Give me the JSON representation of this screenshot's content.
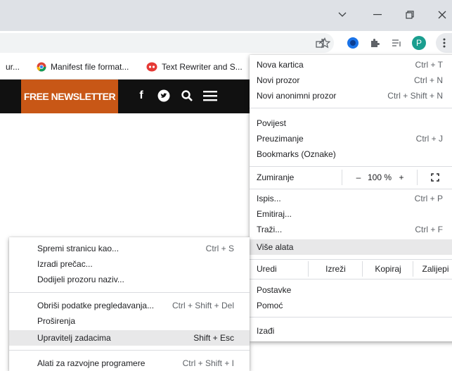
{
  "bookmarks": [
    {
      "label": "ur...",
      "icon": "none"
    },
    {
      "label": "Manifest file format...",
      "icon": "chrome-icon"
    },
    {
      "label": "Text Rewriter and S...",
      "icon": "rewriter-icon"
    }
  ],
  "site": {
    "newsletter": "FREE NEWSLETTER",
    "facebook": "f"
  },
  "profile_initial": "P",
  "main_menu": {
    "items": [
      {
        "label": "Nova kartica",
        "shortcut": "Ctrl + T"
      },
      {
        "label": "Novi prozor",
        "shortcut": "Ctrl + N"
      },
      {
        "label": "Novi anonimni prozor",
        "shortcut": "Ctrl + Shift + N"
      },
      {
        "label": "Povijest",
        "shortcut": ""
      },
      {
        "label": "Preuzimanje",
        "shortcut": "Ctrl + J"
      },
      {
        "label": "Bookmarks (Oznake)",
        "shortcut": ""
      },
      {
        "label": "Ispis...",
        "shortcut": "Ctrl + P"
      },
      {
        "label": "Emitiraj...",
        "shortcut": ""
      },
      {
        "label": "Traži...",
        "shortcut": "Ctrl + F"
      },
      {
        "label": "Više alata",
        "shortcut": ""
      },
      {
        "label": "Postavke",
        "shortcut": ""
      },
      {
        "label": "Pomoć",
        "shortcut": ""
      },
      {
        "label": "Izađi",
        "shortcut": ""
      }
    ],
    "zoom": {
      "label": "Zumiranje",
      "minus": "–",
      "value": "100 %",
      "plus": "+"
    },
    "edit": {
      "label": "Uredi",
      "cut": "Izreži",
      "copy": "Kopiraj",
      "paste": "Zalijepi"
    }
  },
  "submenu": {
    "items": [
      {
        "label": "Spremi stranicu kao...",
        "shortcut": "Ctrl + S"
      },
      {
        "label": "Izradi prečac...",
        "shortcut": ""
      },
      {
        "label": "Dodijeli prozoru naziv...",
        "shortcut": ""
      },
      {
        "label": "Obriši podatke pregledavanja...",
        "shortcut": "Ctrl + Shift + Del"
      },
      {
        "label": "Proširenja",
        "shortcut": ""
      },
      {
        "label": "Upravitelj zadacima",
        "shortcut": "Shift + Esc"
      },
      {
        "label": "Alati za razvojne programere",
        "shortcut": "Ctrl + Shift + I"
      }
    ]
  },
  "colors": {
    "accent": "#c85716",
    "profile": "#1a9e8f",
    "header": "#111111"
  }
}
